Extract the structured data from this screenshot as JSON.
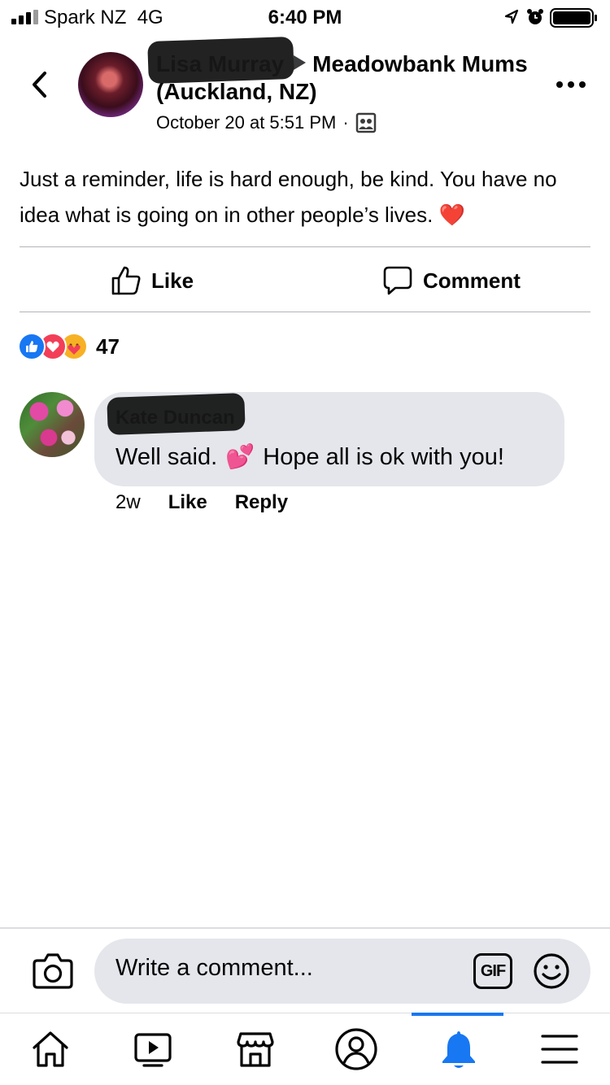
{
  "status_bar": {
    "carrier": "Spark NZ",
    "network": "4G",
    "time": "6:40 PM"
  },
  "post": {
    "author": "Lisa Murray",
    "group": "Meadowbank Mums (Auckland, NZ)",
    "timestamp": "October 20 at 5:51 PM",
    "privacy_icon": "group-members-icon",
    "text": "Just a reminder, life is hard enough, be kind. You have no idea what is going on in other people’s lives. ❤️",
    "actions": {
      "like_label": "Like",
      "comment_label": "Comment"
    },
    "reactions": {
      "icons": [
        "like-reaction-icon",
        "love-reaction-icon",
        "care-reaction-icon"
      ],
      "count": "47"
    }
  },
  "comment": {
    "author": "Kate Duncan",
    "text_before": "Well said.",
    "emoji": "💕",
    "text_after": "Hope all is ok with you!",
    "time": "2w",
    "like_label": "Like",
    "reply_label": "Reply"
  },
  "composer": {
    "placeholder": "Write a comment...",
    "gif_label": "GIF"
  },
  "tabs": [
    {
      "name": "home",
      "icon": "home-icon"
    },
    {
      "name": "watch",
      "icon": "video-icon"
    },
    {
      "name": "marketplace",
      "icon": "store-icon"
    },
    {
      "name": "profile",
      "icon": "profile-icon"
    },
    {
      "name": "notifications",
      "icon": "bell-icon",
      "active": true
    },
    {
      "name": "menu",
      "icon": "menu-icon"
    }
  ],
  "colors": {
    "accent": "#1877f2",
    "bubble": "#e4e6eb",
    "text": "#050505"
  }
}
